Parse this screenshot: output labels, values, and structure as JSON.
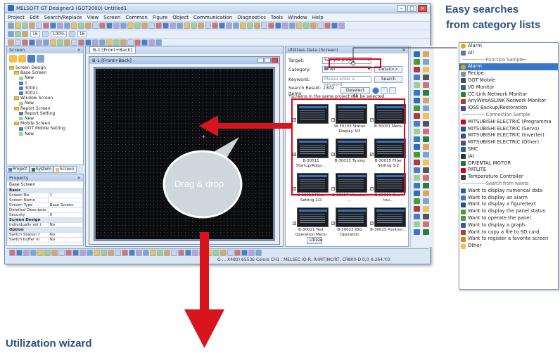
{
  "app": {
    "title": "MELSOFT GT Designer3 (GOT2000) Untitled1",
    "menus": [
      "Project",
      "Edit",
      "Search/Replace",
      "View",
      "Screen",
      "Common",
      "Figure",
      "Object",
      "Communication",
      "Diagnostics",
      "Tools",
      "Window",
      "Help"
    ],
    "toolbar_fields": [
      "16",
      "100%",
      "16"
    ]
  },
  "screen_pane": {
    "title": "Screen",
    "tree": [
      {
        "label": "Screen Design",
        "level": 0,
        "kind": "root"
      },
      {
        "label": "Base Screen",
        "level": 1,
        "kind": "folder"
      },
      {
        "label": "New",
        "level": 2,
        "kind": "new"
      },
      {
        "label": "1",
        "level": 2,
        "kind": "screen"
      },
      {
        "label": "30001",
        "level": 2,
        "kind": "screen"
      },
      {
        "label": "30021",
        "level": 2,
        "kind": "screen"
      },
      {
        "label": "Window Screen",
        "level": 1,
        "kind": "folder"
      },
      {
        "label": "New",
        "level": 2,
        "kind": "new"
      },
      {
        "label": "Report Screen",
        "level": 1,
        "kind": "folder"
      },
      {
        "label": "Report Setting",
        "level": 2,
        "kind": "screen"
      },
      {
        "label": "New",
        "level": 2,
        "kind": "new"
      },
      {
        "label": "Mobile Screen",
        "level": 1,
        "kind": "folder"
      },
      {
        "label": "GOT Mobile Setting",
        "level": 2,
        "kind": "screen"
      },
      {
        "label": "New",
        "level": 2,
        "kind": "new"
      }
    ],
    "tabs": [
      "Project",
      "System",
      "Screen"
    ]
  },
  "property_pane": {
    "title": "Property",
    "header": "Base Screen",
    "rows": [
      {
        "k": "Basic",
        "v": "",
        "section": true
      },
      {
        "k": "Screen No.",
        "v": "1"
      },
      {
        "k": "Screen Name",
        "v": ""
      },
      {
        "k": "Screen Type",
        "v": "Base Screen"
      },
      {
        "k": "Detailed Descriptio",
        "v": ""
      },
      {
        "k": "Security",
        "v": "0"
      },
      {
        "k": "Screen Design",
        "v": "",
        "section": true
      },
      {
        "k": "Individually set t",
        "v": "No"
      },
      {
        "k": "Option",
        "v": "",
        "section": true
      },
      {
        "k": "Switch Station f",
        "v": "No"
      },
      {
        "k": "Switch buffer m",
        "v": "No"
      }
    ]
  },
  "editor": {
    "tab": "B-1:[Front+Back]",
    "inner_title": "B-1:[Front+Back]"
  },
  "utilities": {
    "title": "Utilities Data (Screen)",
    "target_label": "Target:",
    "target_value": "Sample proje",
    "category_label": "Category:",
    "category_value": "All",
    "detail_button": "Detail>>",
    "keyword_label": "Keyword:",
    "keyword_placeholder": "Please enter a keyword",
    "search_button": "Search",
    "result_text": "Search Result: 1302 Items",
    "deselect_button": "Deselect All",
    "note": "*Screens in the same project can be selected.",
    "thumbs": [
      {
        "caption": "",
        "checked": true
      },
      {
        "caption": "W-30103 Status Display 3/3",
        "checked": true
      },
      {
        "caption": "B-30001 Menu",
        "checked": true
      },
      {
        "caption": "B-30011 Startup/Adjus...",
        "checked": true
      },
      {
        "caption": "B-30013 Tuning",
        "checked": true
      },
      {
        "caption": "B-30015 Filter Setting 1/2",
        "checked": true
      },
      {
        "caption": "B-30016 Filter Setting 2/2",
        "checked": true
      },
      {
        "caption": "B-30017 Vibration ...",
        "checked": true
      },
      {
        "caption": "B-30019 One-tou...",
        "checked": true
      },
      {
        "caption": "B-30021 Test Operation Menu",
        "checked": true
      },
      {
        "caption": "B-30023 JOG Operation",
        "checked": true
      },
      {
        "caption": "B-30025 Position...",
        "checked": true
      }
    ],
    "utilize_button": "Utilize"
  },
  "status": {
    "text": "G ... X480)  65536 Colors  CH1 : MELSEC iQ-R, RnMT/NC/RT, CR800-D   0,0        X:264,Y:0"
  },
  "annotations": {
    "easy_line1": "Easy searches",
    "easy_line2": "from category lists",
    "bubble": "Drag & drop",
    "wizard": "Utilization wizard"
  },
  "category_list": [
    {
      "label": "Alarm",
      "type": "item",
      "icon": "alarm-icon",
      "color": "#e8a600"
    },
    {
      "label": "All",
      "type": "item",
      "icon": "all-icon",
      "color": "#4d7cc4"
    },
    {
      "label": "---------------Function Sample--",
      "type": "sep"
    },
    {
      "label": "Alarm",
      "type": "item",
      "icon": "alarm-icon",
      "color": "#e8a600",
      "selected": true
    },
    {
      "label": "Recipe",
      "type": "item",
      "icon": "recipe-icon",
      "color": "#7a8fa8"
    },
    {
      "label": "GOT Mobile",
      "type": "item",
      "icon": "got-mobile-icon",
      "color": "#3b4f6b"
    },
    {
      "label": "I/O Monitor",
      "type": "item",
      "icon": "io-monitor-icon",
      "color": "#2f5fa8"
    },
    {
      "label": "CC-Link Network Monitor",
      "type": "item",
      "icon": "network-icon",
      "color": "#2e7d32"
    },
    {
      "label": "AnyWireASLINK Network Monitor",
      "type": "item",
      "icon": "network-icon",
      "color": "#b23a3a"
    },
    {
      "label": "iQSS Backup/Restoration",
      "type": "item",
      "icon": "backup-icon",
      "color": "#4a4a8a"
    },
    {
      "label": "---------------Connection Sample",
      "type": "sep"
    },
    {
      "label": "MITSUBISHI ELECTRIC (Programma",
      "type": "item",
      "icon": "mitsubishi-icon",
      "color": "#d2001a"
    },
    {
      "label": "MITSUBISHI ELECTRIC (Servo)",
      "type": "item",
      "icon": "servo-icon",
      "color": "#2b4f8a"
    },
    {
      "label": "MITSUBISHI ELECTRIC (Inverter)",
      "type": "item",
      "icon": "inverter-icon",
      "color": "#2b4f8a"
    },
    {
      "label": "MITSUBISHI ELECTRIC (Other)",
      "type": "item",
      "icon": "device-icon",
      "color": "#555555"
    },
    {
      "label": "SMC",
      "type": "item",
      "icon": "smc-icon",
      "color": "#1d5fb4"
    },
    {
      "label": "IAI",
      "type": "item",
      "icon": "iai-icon",
      "color": "#333333"
    },
    {
      "label": "ORIENTAL MOTOR",
      "type": "item",
      "icon": "oriental-motor-icon",
      "color": "#2d6f3a"
    },
    {
      "label": "PATLITE",
      "type": "item",
      "icon": "patlite-icon",
      "color": "#d2001a"
    },
    {
      "label": "Temperature Controller",
      "type": "item",
      "icon": "temperature-icon",
      "color": "#3b3b3b"
    },
    {
      "label": "---------------Search from wants",
      "type": "sep"
    },
    {
      "label": "Want to display numerical data",
      "type": "item",
      "icon": "numeric-icon",
      "color": "#2f5fa8"
    },
    {
      "label": "Want to display an alarm",
      "type": "item",
      "icon": "alarm-display-icon",
      "color": "#3b77c9"
    },
    {
      "label": "Want to display a figure/text",
      "type": "item",
      "icon": "text-icon",
      "color": "#1f4f9a"
    },
    {
      "label": "Want to display the panel status",
      "type": "item",
      "icon": "panel-status-icon",
      "color": "#4c9a2a"
    },
    {
      "label": "Want to operate the panel",
      "type": "item",
      "icon": "operate-icon",
      "color": "#4c9a2a"
    },
    {
      "label": "Want to display a graph",
      "type": "item",
      "icon": "graph-icon",
      "color": "#2f5fa8"
    },
    {
      "label": "Want to copy a file to SD card",
      "type": "item",
      "icon": "sd-card-icon",
      "color": "#c0392b"
    },
    {
      "label": "Want to register a favorite screen",
      "type": "item",
      "icon": "favorite-icon",
      "color": "#e67e22"
    },
    {
      "label": "Other",
      "type": "item",
      "icon": "folder-icon",
      "color": "#f0c14b"
    }
  ],
  "colors": {
    "accent_red": "#e2001a",
    "arrow_red": "#d8141c",
    "heading_blue": "#2c4f7c",
    "selection_blue": "#3b77c9"
  }
}
